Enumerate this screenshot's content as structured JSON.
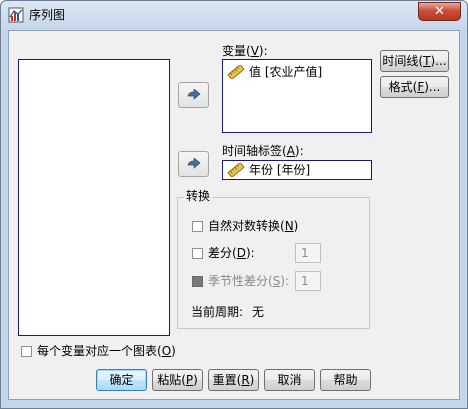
{
  "window": {
    "title": "序列图",
    "close_symbol": "✕"
  },
  "variables": {
    "label": "变量(",
    "key": "V",
    "label_end": "):",
    "items": [
      {
        "text": "值 [农业产值]",
        "icon": "ruler-icon"
      }
    ]
  },
  "time_axis": {
    "label": "时间轴标签(",
    "key": "A",
    "label_end": "):",
    "value": "年份 [年份]",
    "icon": "ruler-icon"
  },
  "side_buttons": {
    "timelines": {
      "text": "时间线(",
      "key": "T",
      "end": ")..."
    },
    "format": {
      "text": "格式(",
      "key": "F",
      "end": ")..."
    }
  },
  "transform": {
    "legend": "转换",
    "natural_log": {
      "text": "自然对数转换(",
      "key": "N",
      "end": ")",
      "checked": false
    },
    "difference": {
      "text": "差分(",
      "key": "D",
      "end": "):",
      "checked": false,
      "value": "1"
    },
    "seasonal_difference": {
      "text": "季节性差分(",
      "key": "S",
      "end": "):",
      "checked": false,
      "enabled": false,
      "value": "1"
    },
    "current_period_label": "当前周期:",
    "current_period_value": "无"
  },
  "one_chart_per_variable": {
    "text": "每个变量对应一个图表(",
    "key": "O",
    "end": ")",
    "checked": false
  },
  "footer": {
    "ok": "确定",
    "paste": {
      "text": "粘贴(",
      "key": "P",
      "end": ")"
    },
    "reset": {
      "text": "重置(",
      "key": "R",
      "end": ")"
    },
    "cancel": "取消",
    "help": "帮助"
  },
  "colors": {
    "title_gradient_top": "#dce8f4",
    "client_bg": "#f0f0f0",
    "list_border": "#1a1a6e",
    "default_button": "#3c7fb1"
  }
}
